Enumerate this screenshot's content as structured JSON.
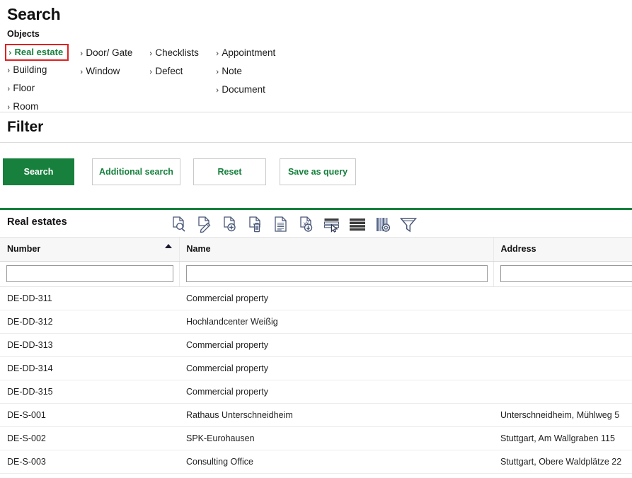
{
  "search": {
    "title": "Search",
    "objects_label": "Objects",
    "object_columns": [
      [
        {
          "label": "Real estate",
          "selected": true
        },
        {
          "label": "Building",
          "selected": false
        },
        {
          "label": "Floor",
          "selected": false
        },
        {
          "label": "Room",
          "selected": false
        }
      ],
      [
        {
          "label": "Door/ Gate",
          "selected": false
        },
        {
          "label": "Window",
          "selected": false
        }
      ],
      [
        {
          "label": "Checklists",
          "selected": false
        },
        {
          "label": "Defect",
          "selected": false
        }
      ],
      [
        {
          "label": "Appointment",
          "selected": false
        },
        {
          "label": "Note",
          "selected": false
        },
        {
          "label": "Document",
          "selected": false
        }
      ]
    ],
    "chevron": "›"
  },
  "filter": {
    "title": "Filter",
    "buttons": {
      "search": "Search",
      "additional_search": "Additional search",
      "reset": "Reset",
      "save_as_query": "Save as query"
    }
  },
  "results": {
    "panel_title": "Real estates",
    "toolbar": [
      {
        "name": "show-details-icon",
        "title": "Show / Details"
      },
      {
        "name": "edit-document-icon",
        "title": "Edit"
      },
      {
        "name": "new-document-icon",
        "title": "New"
      },
      {
        "name": "delete-document-icon",
        "title": "Delete"
      },
      {
        "name": "report-icon",
        "title": "Report"
      },
      {
        "name": "export-excel-icon",
        "title": "Export"
      },
      {
        "name": "select-rows-icon",
        "title": "Select rows"
      },
      {
        "name": "list-layout-icon",
        "title": "List layout"
      },
      {
        "name": "column-settings-icon",
        "title": "Column settings"
      },
      {
        "name": "filter-funnel-icon",
        "title": "Filter"
      }
    ],
    "columns": [
      {
        "key": "number",
        "label": "Number",
        "sorted": "asc"
      },
      {
        "key": "name",
        "label": "Name",
        "sorted": ""
      },
      {
        "key": "address",
        "label": "Address",
        "sorted": ""
      }
    ],
    "filter_inputs": {
      "number": "",
      "name": "",
      "address": ""
    },
    "rows": [
      {
        "number": "DE-DD-311",
        "name": "Commercial property",
        "address": ""
      },
      {
        "number": "DE-DD-312",
        "name": "Hochlandcenter Weißig",
        "address": ""
      },
      {
        "number": "DE-DD-313",
        "name": "Commercial property",
        "address": ""
      },
      {
        "number": "DE-DD-314",
        "name": "Commercial property",
        "address": ""
      },
      {
        "number": "DE-DD-315",
        "name": "Commercial property",
        "address": ""
      },
      {
        "number": "DE-S-001",
        "name": "Rathaus Unterschneidheim",
        "address": "Unterschneidheim, Mühlweg 5"
      },
      {
        "number": "DE-S-002",
        "name": "SPK-Eurohausen",
        "address": "Stuttgart, Am Wallgraben 115"
      },
      {
        "number": "DE-S-003",
        "name": "Consulting Office",
        "address": "Stuttgart, Obere Waldplätze 22"
      }
    ]
  },
  "colors": {
    "brand_green": "#16803c",
    "highlight_red": "#e02020",
    "header_bg": "#f7f7f7",
    "icon_outline": "#4a5878"
  }
}
